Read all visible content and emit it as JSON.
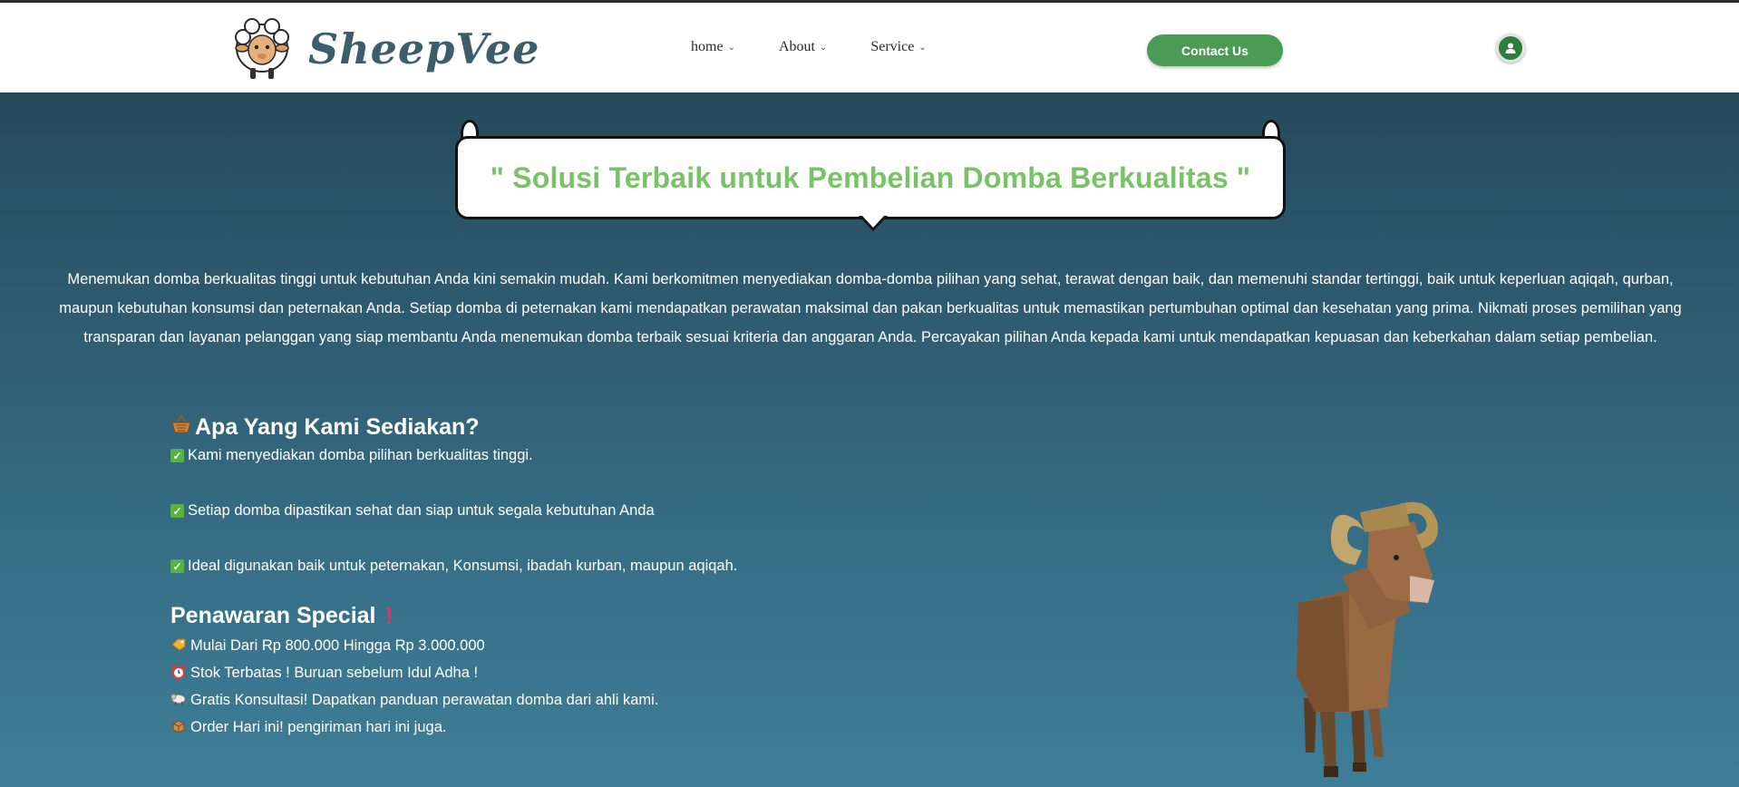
{
  "brand": {
    "name": "SheepVee"
  },
  "nav": {
    "items": [
      {
        "label": "home"
      },
      {
        "label": "About"
      },
      {
        "label": "Service"
      }
    ],
    "contact_label": "Contact Us"
  },
  "hero": {
    "title": "\" Solusi Terbaik untuk Pembelian Domba Berkualitas \"",
    "intro_lines": [
      "Menemukan domba berkualitas tinggi untuk kebutuhan Anda kini semakin mudah. Kami berkomitmen menyediakan domba-domba pilihan yang sehat, terawat dengan baik, dan memenuhi standar tertinggi, baik untuk keperluan aqiqah, qurban,",
      "maupun kebutuhan konsumsi dan peternakan Anda. Setiap domba di peternakan kami mendapatkan perawatan maksimal dan pakan berkualitas untuk memastikan pertumbuhan optimal dan kesehatan yang prima. Nikmati proses pemilihan yang",
      "transparan dan layanan pelanggan yang siap membantu Anda menemukan domba terbaik sesuai kriteria dan anggaran Anda. Percayakan pilihan Anda kepada kami untuk mendapatkan kepuasan dan keberkahan dalam setiap pembelian."
    ]
  },
  "provide": {
    "heading": "Apa Yang Kami Sediakan?",
    "heading_icon": "basket-icon",
    "items": [
      "Kami menyediakan domba pilihan berkualitas tinggi.",
      "Setiap domba dipastikan sehat dan siap untuk segala kebutuhan Anda",
      "Ideal digunakan baik untuk peternakan, Konsumsi, ibadah kurban, maupun aqiqah."
    ]
  },
  "offer": {
    "heading": "Penawaran Special",
    "heading_icon": "exclamation-icon",
    "items": [
      {
        "icon": "price-tag-icon",
        "text": "Mulai Dari Rp 800.000 Hingga Rp 3.000.000"
      },
      {
        "icon": "alarm-clock-icon",
        "text": "Stok Terbatas ! Buruan sebelum Idul Adha !"
      },
      {
        "icon": "ram-icon",
        "text": "Gratis Konsultasi! Dapatkan panduan perawatan domba dari ahli kami."
      },
      {
        "icon": "package-icon",
        "text": "Order Hari ini! pengiriman hari ini juga."
      }
    ]
  },
  "colors": {
    "accent_green": "#4b9a55",
    "title_green": "#7ac26a",
    "hero_bg_top": "#264a5b",
    "hero_bg_bottom": "#3e7e97"
  }
}
